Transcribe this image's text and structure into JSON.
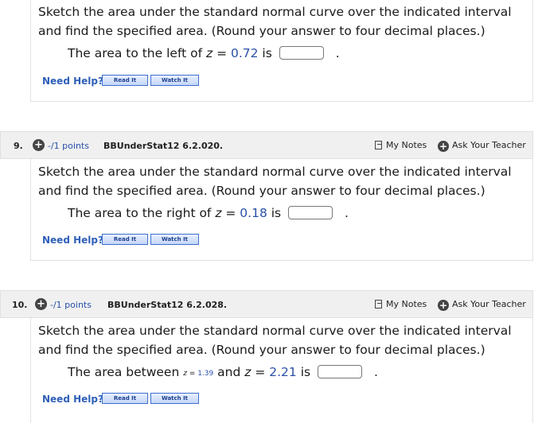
{
  "questions": [
    {
      "prompt_line1": "Sketch the area under the standard normal curve over the indicated interval",
      "prompt_line2": "and find the specified area. (Round your answer to four decimal places.)",
      "answer_prefix": "The area to the left of ",
      "var": "z",
      "eq": " = ",
      "value": "0.72",
      "answer_suffix": " is",
      "period": ".",
      "help_label": "Need Help?",
      "read_label": "Read It",
      "watch_label": "Watch It"
    },
    {
      "number": "9.",
      "points": "-/1 points",
      "source": "BBUnderStat12 6.2.020.",
      "notes_label": "My Notes",
      "ask_label": "Ask Your Teacher",
      "prompt_line1": "Sketch the area under the standard normal curve over the indicated interval",
      "prompt_line2": "and find the specified area. (Round your answer to four decimal places.)",
      "answer_prefix": "The area to the right of ",
      "var": "z",
      "eq": " = ",
      "value": "0.18",
      "answer_suffix": " is",
      "period": ".",
      "help_label": "Need Help?",
      "read_label": "Read It",
      "watch_label": "Watch It"
    },
    {
      "number": "10.",
      "points": "-/1 points",
      "source": "BBUnderStat12 6.2.028.",
      "notes_label": "My Notes",
      "ask_label": "Ask Your Teacher",
      "prompt_line1": "Sketch the area under the standard normal curve over the indicated interval",
      "prompt_line2": "and find the specified area. (Round your answer to four decimal places.)",
      "answer_prefix": "The area between ",
      "small_var": "z",
      "small_eq": " = ",
      "small_value": "1.39",
      "mid_text": " and ",
      "var": "z",
      "eq": " = ",
      "value": "2.21",
      "answer_suffix": " is",
      "period": ".",
      "help_label": "Need Help?",
      "read_label": "Read It",
      "watch_label": "Watch It"
    }
  ],
  "colors": {
    "link_blue": "#2f5fb8",
    "value_blue": "#2a50a8",
    "header_bg": "#f0f0f0",
    "icon_dark": "#444444"
  },
  "icons": [
    "plus-circle-icon",
    "notes-icon",
    "ask-plus-icon"
  ]
}
